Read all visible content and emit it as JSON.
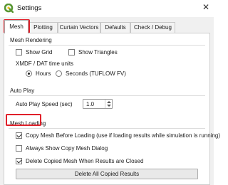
{
  "window": {
    "title": "Settings",
    "close_glyph": "✕"
  },
  "tabs": [
    "Mesh",
    "Plotting",
    "Curtain Vectors",
    "Defaults",
    "Check / Debug"
  ],
  "mesh_rendering": {
    "title": "Mesh Rendering",
    "show_grid": {
      "label": "Show Grid",
      "checked": false
    },
    "show_triangles": {
      "label": "Show Triangles",
      "checked": false
    },
    "time_units_label": "XMDF / DAT time units",
    "hours": {
      "label": "Hours",
      "selected": true
    },
    "seconds": {
      "label": "Seconds (TUFLOW FV)",
      "selected": false
    }
  },
  "auto_play": {
    "title": "Auto Play",
    "speed_label": "Auto Play Speed (sec)",
    "speed_value": "1.0"
  },
  "mesh_loading": {
    "title": "Mesh Loading",
    "copy_before": {
      "label": "Copy Mesh Before Loading (use if loading results while simulation is running)",
      "checked": true
    },
    "always_show": {
      "label": "Always Show Copy Mesh Dialog",
      "checked": false
    },
    "delete_copied": {
      "label": "Delete Copied Mesh When Results are Closed",
      "checked": true
    },
    "delete_all_button": "Delete All Copied Results"
  },
  "colors": {
    "highlight": "#e0202a",
    "qgis_green": "#589632",
    "qgis_yellow": "#f0c419"
  }
}
